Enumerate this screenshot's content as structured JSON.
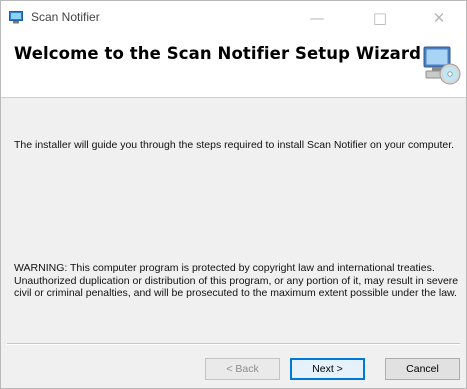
{
  "window": {
    "title": "Scan Notifier",
    "caption": {
      "minimize": "—",
      "maximize": "□",
      "close": "✕"
    }
  },
  "banner": {
    "title": "Welcome to the Scan Notifier Setup Wizard",
    "icon": "setup-computer-icon"
  },
  "body": {
    "intro": "The installer will guide you through the steps required to install Scan Notifier on your computer.",
    "warning": "WARNING: This computer program is protected by copyright law and international treaties. Unauthorized duplication or distribution of this program, or any portion of it, may result in severe civil or criminal penalties, and will be prosecuted to the maximum extent possible under the law."
  },
  "buttons": {
    "back": "< Back",
    "next": "Next >",
    "cancel": "Cancel"
  },
  "colors": {
    "accent": "#0078d7",
    "face": "#f0f0f0",
    "banner": "#ffffff"
  }
}
